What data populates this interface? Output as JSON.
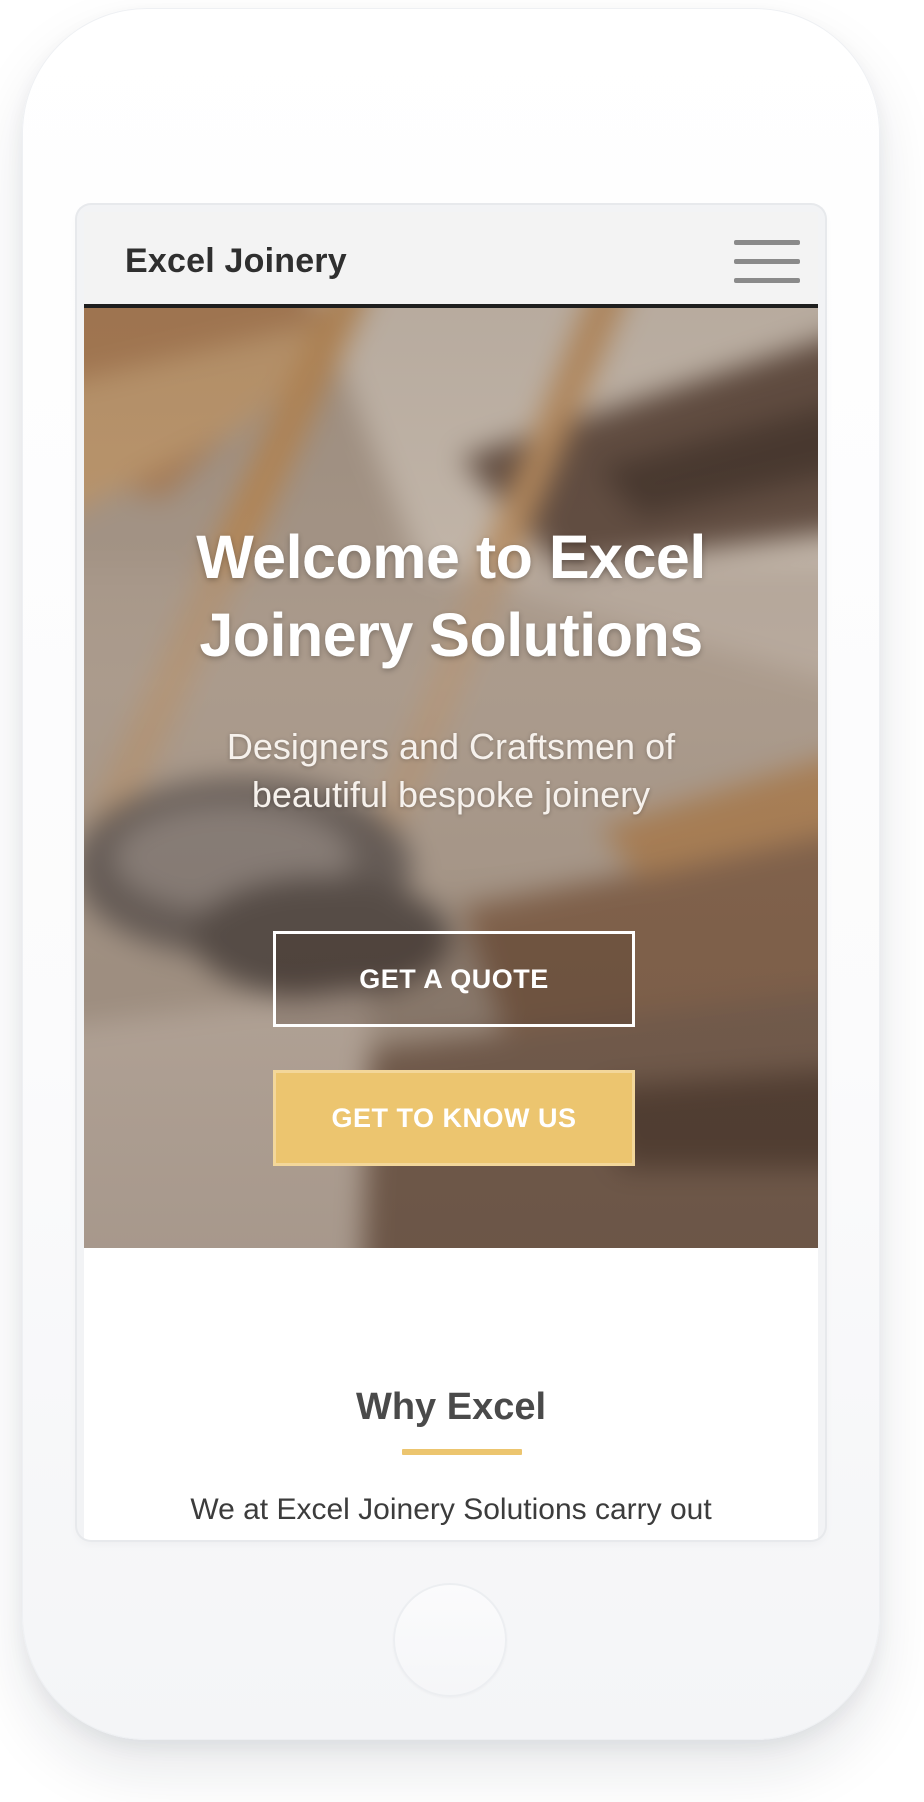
{
  "header": {
    "brand": "Excel Joinery",
    "menu_icon": "hamburger-menu-icon"
  },
  "hero": {
    "title": "Welcome to Excel Joinery Solutions",
    "subtitle": "Designers and Craftsmen of beautiful bespoke joinery",
    "primary_button": "GET A QUOTE",
    "secondary_button": "GET TO KNOW US",
    "background_image": "blurred-woodworking-tools-photo"
  },
  "why": {
    "heading": "Why Excel",
    "intro": "We at Excel Joinery Solutions carry out"
  },
  "device": {
    "home_button_icon": "home-button-icon"
  },
  "colors": {
    "accent": "#ecc56f",
    "header_bg": "#f3f3f3",
    "header_border": "#1e1e1e",
    "text_dark": "#2f2f2f"
  }
}
